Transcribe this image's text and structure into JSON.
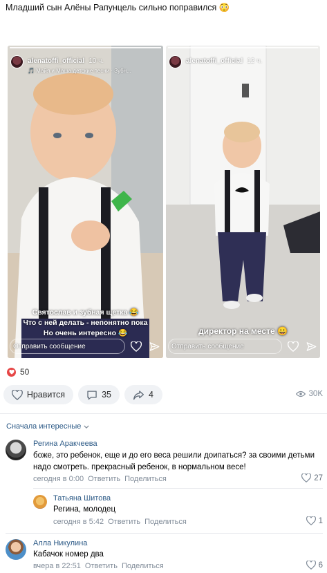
{
  "post": {
    "text": "Младший сын Алёны Рапунцель сильно поправился 😳"
  },
  "stories": [
    {
      "user": "alenatoffi_official",
      "time": "10 ч.",
      "music": "🎵 Майя и Маша детские песни · Зубн...",
      "caption": [
        "Святослав и зубная щетка 😂",
        "Что с ней делать - непонятно пока",
        "Но очень интересно 😂"
      ],
      "reply_placeholder": "Отправить сообщение"
    },
    {
      "user": "alenatoffi_official",
      "time": "12 ч.",
      "music": "",
      "caption": [
        "директор на месте 😀"
      ],
      "reply_placeholder": "Отправить сообщение"
    }
  ],
  "reactions": {
    "count": "50"
  },
  "actions": {
    "like_label": "Нравится",
    "comments_count": "35",
    "shares_count": "4",
    "views": "30K"
  },
  "comments_sort": "Сначала интересные",
  "comments": [
    {
      "author": "Регина Аракчеева",
      "text": "боже, это ребенок, еще и до его веса решили доипаться? за своими детьми надо смотреть. прекрасный ребенок, в нормальном весе!",
      "time": "сегодня в 0:00",
      "reply": "Ответить",
      "share": "Поделиться",
      "likes": "27"
    },
    {
      "author": "Татьяна Шитова",
      "text": "Регина, молодец",
      "time": "сегодня в 5:42",
      "reply": "Ответить",
      "share": "Поделиться",
      "likes": "1"
    },
    {
      "author": "Алла Никулина",
      "text": "Кабачок номер два",
      "time": "вчера в 22:51",
      "reply": "Ответить",
      "share": "Поделиться",
      "likes": "6"
    }
  ],
  "colors": {
    "link": "#2a5885",
    "meta": "#818c99",
    "heart": "#e64646",
    "pill_bg": "#f0f2f5"
  }
}
